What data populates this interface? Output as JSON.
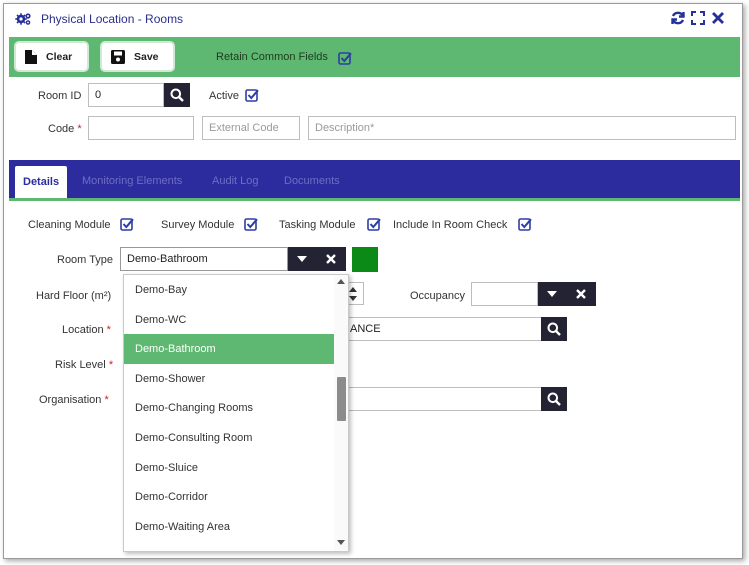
{
  "window": {
    "title": "Physical Location - Rooms"
  },
  "toolbar": {
    "clear_label": "Clear",
    "save_label": "Save",
    "retain_label": "Retain Common Fields"
  },
  "form": {
    "room_id_label": "Room ID",
    "room_id_value": "0",
    "active_label": "Active",
    "code_label": "Code",
    "code_value": "",
    "external_code_placeholder": "External Code",
    "description_placeholder": "Description*",
    "required_mark": "*"
  },
  "tabs": [
    {
      "label": "Details"
    },
    {
      "label": "Monitoring Elements"
    },
    {
      "label": "Audit Log"
    },
    {
      "label": "Documents"
    }
  ],
  "details": {
    "cleaning_module_label": "Cleaning Module",
    "survey_module_label": "Survey Module",
    "tasking_module_label": "Tasking Module",
    "include_room_check_label": "Include In Room Check",
    "room_type_label": "Room Type",
    "room_type_value": "Demo-Bathroom",
    "hard_floor_label": "Hard Floor (m²)",
    "occupancy_label": "Occupancy",
    "location_label": "Location",
    "location_value_partial": "ANCE",
    "risk_level_label": "Risk Level",
    "organisation_label": "Organisation",
    "room_type_color": "#0c8a17"
  },
  "dropdown": {
    "options": [
      "Demo-Bay",
      "Demo-WC",
      "Demo-Bathroom",
      "Demo-Shower",
      "Demo-Changing Rooms",
      "Demo-Consulting Room",
      "Demo-Sluice",
      "Demo-Corridor",
      "Demo-Waiting Area"
    ],
    "selected": "Demo-Bathroom"
  },
  "colors": {
    "accent_green": "#5fb872",
    "tab_blue": "#2d2c9e",
    "dark_button": "#232333",
    "checkbox_blue": "#2d3da5"
  }
}
